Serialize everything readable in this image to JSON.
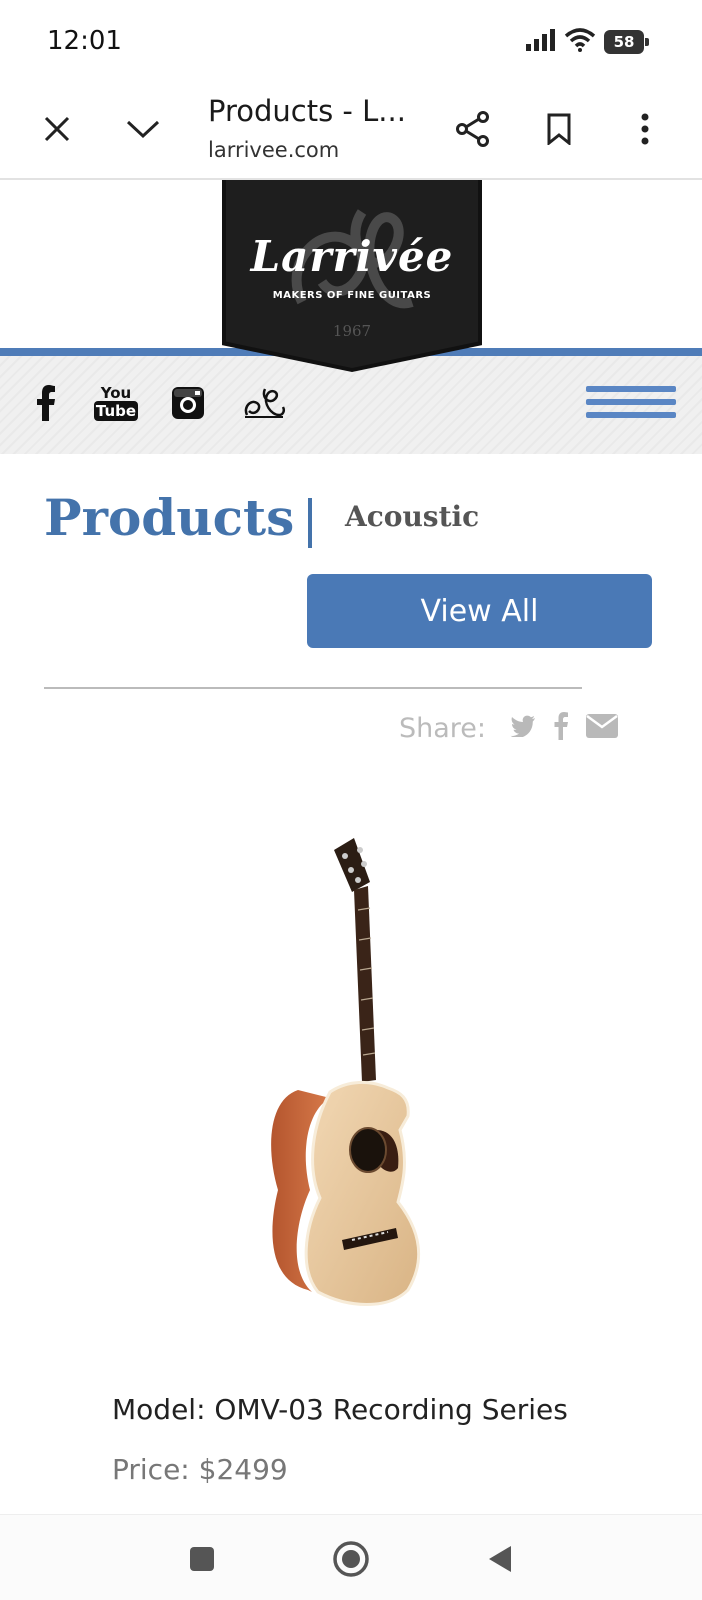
{
  "status_bar": {
    "time": "12:01",
    "battery": "58",
    "icons": [
      "signal-icon",
      "wifi-icon",
      "battery-icon"
    ]
  },
  "browser": {
    "title": "Products - L...",
    "url": "larrivee.com",
    "icons": [
      "close-icon",
      "chevron-down-icon",
      "share-icon",
      "bookmark-icon",
      "more-vert-icon"
    ]
  },
  "logo": {
    "script": "Larrivée",
    "tagline": "MAKERS OF FINE GUITARS",
    "year": "1967"
  },
  "social": {
    "items": [
      "facebook-icon",
      "youtube-icon",
      "instagram-icon",
      "larrivee-monogram-icon"
    ],
    "youtube_top": "You",
    "youtube_bottom": "Tube"
  },
  "page": {
    "heading": "Products",
    "category": "Acoustic",
    "view_all_label": "View All"
  },
  "share": {
    "label": "Share:",
    "icons": [
      "twitter-icon",
      "facebook-icon",
      "email-icon"
    ]
  },
  "product": {
    "model": "Model: OMV-03 Recording Series",
    "price": "Price: $2499"
  },
  "colors": {
    "brand_blue": "#4a79b6",
    "heading_blue": "#4473ab",
    "menu_blue": "#5a86c4"
  },
  "nav_bar": {
    "icons": [
      "recents-icon",
      "home-icon",
      "back-icon"
    ]
  }
}
